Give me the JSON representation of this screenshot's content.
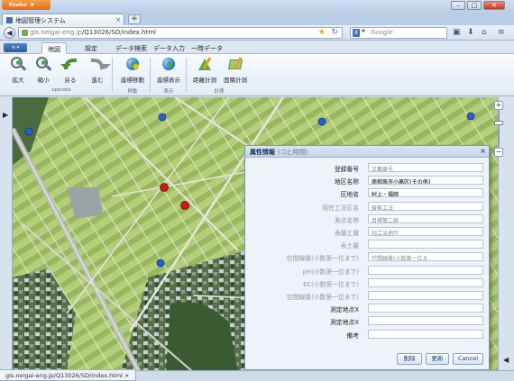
{
  "browser": {
    "menu_label": "Firefox",
    "tab_title": "地図管理システム",
    "url_host": "gis.neigai-eng.jp",
    "url_path": "/Q13026/SD/index.html",
    "search_placeholder": "Google",
    "search_engine_glyph": "8",
    "status_url": "gis.neigai-eng.jp/Q13026/SD/index.html"
  },
  "ribbon": {
    "app_menu_label": "≡",
    "tabs": [
      {
        "label": "地図",
        "active": true
      },
      {
        "label": "設定",
        "active": false
      },
      {
        "label": "データ検索",
        "active": false
      },
      {
        "label": "データ入力",
        "active": false
      },
      {
        "label": "一時データ",
        "active": false
      }
    ],
    "buttons": {
      "zoom_in": "拡大",
      "zoom_out": "縮小",
      "back": "戻る",
      "forward": "進む",
      "coord_move": "座標移動",
      "coord_show": "座標表示",
      "measure_distance": "距離計測",
      "measure_area": "面積計測"
    },
    "groups": {
      "operate": "operate",
      "move": "移動",
      "display": "表示",
      "measure": "計測"
    }
  },
  "map": {
    "colors": {
      "field": "#a7c56f",
      "field_alt": "#8fb45d",
      "road": "#e8e6dc",
      "marker_blue": "#2a5fd0",
      "marker_red": "#cc1b1b"
    },
    "markers": [
      {
        "type": "blue"
      },
      {
        "type": "blue"
      },
      {
        "type": "blue"
      },
      {
        "type": "blue"
      },
      {
        "type": "blue"
      },
      {
        "type": "red"
      },
      {
        "type": "red"
      }
    ],
    "zoom_in_glyph": "+",
    "zoom_out_glyph": "−",
    "left_toggle": "▶",
    "right_toggle": "◀"
  },
  "dialog": {
    "title": "属性情報",
    "subtitle": "(コヒ時間)",
    "close_glyph": "×",
    "rows": [
      {
        "label": "登録番号",
        "value": "正義番号",
        "dim": false,
        "style": "dimtext"
      },
      {
        "label": "地区名称",
        "value": "南相馬市小高区(その他)",
        "dim": false,
        "style": "blur"
      },
      {
        "label": "区地名",
        "value": "村上・福岡",
        "dim": false,
        "style": "blur"
      },
      {
        "label": "現在工法区名",
        "value": "緩衝工法",
        "dim": true,
        "style": "dimtext"
      },
      {
        "label": "測点名称",
        "value": "目標第二級",
        "dim": true,
        "style": "dimtext"
      },
      {
        "label": "表層土層",
        "value": "旧工法地区",
        "dim": true,
        "style": "dimtext"
      },
      {
        "label": "表土層",
        "value": "",
        "dim": true,
        "style": "dimtext"
      },
      {
        "label": "空間線量(小数第一位まで)",
        "value": "空間線量(小数第一位ま",
        "dim": true,
        "style": "dimtext"
      },
      {
        "label": "pH(小数第一位まで)",
        "value": "",
        "dim": true,
        "style": "dimtext"
      },
      {
        "label": "EC(小数第一位まで)",
        "value": "",
        "dim": true,
        "style": "dimtext"
      },
      {
        "label": "空間線量(小数第一位まで)",
        "value": "",
        "dim": true,
        "style": "dimtext"
      },
      {
        "label": "測定地点X",
        "value": "",
        "dim": false,
        "style": "dimtext"
      },
      {
        "label": "測定地点X",
        "value": "",
        "dim": false,
        "style": "dimtext"
      },
      {
        "label": "備考",
        "value": "",
        "dim": false,
        "style": "dimtext"
      }
    ],
    "buttons": {
      "delete": "削除",
      "update": "更新",
      "cancel": "Cancel"
    }
  }
}
